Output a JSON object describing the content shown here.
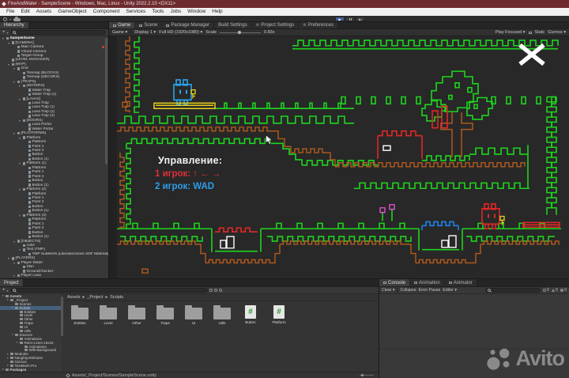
{
  "window": {
    "title": "FireAndWater - SampleScene - Windows, Mac, Linux - Unity 2022.2.10 <DX11>"
  },
  "menus": [
    "File",
    "Edit",
    "Assets",
    "GameObject",
    "Component",
    "Services",
    "Tools",
    "Jobs",
    "Window",
    "Help"
  ],
  "hierarchy": {
    "tab": "Hierarchy",
    "rows": [
      [
        0,
        "SampleScene",
        1,
        ""
      ],
      [
        1,
        "[CAMERA]",
        1,
        ""
      ],
      [
        2,
        "Main Camera",
        0,
        "red"
      ],
      [
        2,
        "Virtual Camera",
        0,
        ""
      ],
      [
        2,
        "Target Group",
        0,
        ""
      ],
      [
        1,
        "[LEVEL MANAGER]",
        0,
        ""
      ],
      [
        1,
        "[MAP]",
        1,
        ""
      ],
      [
        2,
        "Grid",
        1,
        ""
      ],
      [
        3,
        "Tilemap (BLOCKS)",
        0,
        ""
      ],
      [
        3,
        "Tilemap (DECORS)",
        0,
        ""
      ],
      [
        2,
        "[TRAPS]",
        1,
        ""
      ],
      [
        3,
        "[WATERS]",
        1,
        ""
      ],
      [
        4,
        "Water Trap",
        0,
        ""
      ],
      [
        4,
        "Water Trap (1)",
        0,
        ""
      ],
      [
        3,
        "[LAVAS]",
        1,
        ""
      ],
      [
        4,
        "Lava Trap",
        0,
        ""
      ],
      [
        4,
        "Lava Trap (1)",
        0,
        ""
      ],
      [
        4,
        "Lava Trap (2)",
        0,
        ""
      ],
      [
        4,
        "Lava Trap (3)",
        0,
        ""
      ],
      [
        3,
        "[DOORS]",
        1,
        ""
      ],
      [
        4,
        "Lava Portal",
        0,
        ""
      ],
      [
        4,
        "Water Portal",
        0,
        ""
      ],
      [
        2,
        "[PLATFORMS]",
        1,
        ""
      ],
      [
        3,
        "Platform",
        1,
        ""
      ],
      [
        4,
        "Platform",
        0,
        ""
      ],
      [
        4,
        "Point 1",
        0,
        ""
      ],
      [
        4,
        "Point 2",
        0,
        ""
      ],
      [
        4,
        "Button",
        0,
        ""
      ],
      [
        4,
        "Button (1)",
        0,
        ""
      ],
      [
        3,
        "Platform (1)",
        1,
        ""
      ],
      [
        4,
        "Platform",
        0,
        ""
      ],
      [
        4,
        "Point 1",
        0,
        ""
      ],
      [
        4,
        "Point 2",
        0,
        ""
      ],
      [
        4,
        "Button",
        0,
        ""
      ],
      [
        4,
        "Button (1)",
        0,
        ""
      ],
      [
        3,
        "Platform (2)",
        1,
        ""
      ],
      [
        4,
        "Platform",
        0,
        ""
      ],
      [
        4,
        "Point 1",
        0,
        ""
      ],
      [
        4,
        "Point 2",
        0,
        ""
      ],
      [
        4,
        "Button",
        0,
        ""
      ],
      [
        4,
        "Button (1)",
        0,
        ""
      ],
      [
        3,
        "Platform (3)",
        1,
        ""
      ],
      [
        4,
        "Platform",
        0,
        ""
      ],
      [
        4,
        "Point 1",
        0,
        ""
      ],
      [
        4,
        "Point 2",
        0,
        ""
      ],
      [
        4,
        "Button",
        0,
        ""
      ],
      [
        4,
        "Button (1)",
        0,
        ""
      ],
      [
        2,
        "[OBJECTS]",
        1,
        ""
      ],
      [
        3,
        "cube",
        0,
        ""
      ],
      [
        3,
        "Text (TMP)",
        1,
        ""
      ],
      [
        4,
        "TMP SubMesh [LiberationSans SDF Material]",
        0,
        ""
      ],
      [
        1,
        "[PLAYERS]",
        1,
        ""
      ],
      [
        2,
        "Player Water",
        1,
        ""
      ],
      [
        3,
        "Skin",
        0,
        ""
      ],
      [
        3,
        "GroundChecker",
        0,
        ""
      ],
      [
        2,
        "Player Lava",
        1,
        ""
      ]
    ]
  },
  "game": {
    "tabs": [
      {
        "label": "Game",
        "icon": "game",
        "active": true
      },
      {
        "label": "Scene",
        "icon": "scene",
        "active": false
      },
      {
        "label": "Package Manager",
        "icon": "package",
        "active": false
      },
      {
        "label": "Build Settings",
        "icon": "",
        "active": false
      },
      {
        "label": "Project Settings",
        "icon": "gear",
        "active": false
      },
      {
        "label": "Preferences",
        "icon": "gear",
        "active": false
      }
    ],
    "bar": {
      "mode": "Game",
      "display": "Display 1",
      "resolution": "Full HD (1920x1080)",
      "scale_label": "Scale",
      "scale_value": "0.83x",
      "play_focused": "Play Focused",
      "stats": "Stats",
      "gizmos": "Gizmos"
    },
    "overlay": {
      "title": "Управление:",
      "player1": "1 игрок: ↑ ← →",
      "player2": "2 игрок: WAD"
    }
  },
  "level_colors": {
    "green": "#1ed41e",
    "orange": "#b55b1c",
    "red": "#e22727",
    "blue_player": "#2aa4ee",
    "blue_water": "#1f7fe8",
    "yellow": "#e8d21f",
    "pink": "#e24fd4",
    "brown": "#a8551e",
    "white": "#ffffff",
    "bg": "#282828"
  },
  "project": {
    "tab": "Project",
    "tree": [
      [
        0,
        "Assets",
        1,
        0
      ],
      [
        1,
        "_Project",
        1,
        0
      ],
      [
        2,
        "Scenes",
        0,
        0
      ],
      [
        2,
        "Scripts",
        1,
        1
      ],
      [
        3,
        "Entities",
        0,
        0
      ],
      [
        3,
        "Level",
        0,
        0
      ],
      [
        3,
        "Other",
        0,
        0
      ],
      [
        3,
        "Traps",
        0,
        0
      ],
      [
        3,
        "UI",
        0,
        0
      ],
      [
        3,
        "Utils",
        0,
        0
      ],
      [
        2,
        "Sources",
        1,
        0
      ],
      [
        3,
        "Animations",
        0,
        0
      ],
      [
        3,
        "Retro-Lines-16x16",
        1,
        0
      ],
      [
        4,
        "Animations",
        0,
        0
      ],
      [
        4,
        "With-Background",
        0,
        0
      ],
      [
        1,
        "Modules",
        1,
        0
      ],
      [
        1,
        "NaughtyAttributes",
        1,
        0
      ],
      [
        1,
        "Gizmos",
        0,
        0
      ],
      [
        1,
        "TextMesh-Pro",
        1,
        0
      ],
      [
        0,
        "Packages",
        1,
        0
      ]
    ],
    "breadcrumb": [
      "Assets",
      "_Project",
      "Scripts"
    ],
    "items": [
      {
        "label": "Entities",
        "type": "folder"
      },
      {
        "label": "Level",
        "type": "folder"
      },
      {
        "label": "Other",
        "type": "folder"
      },
      {
        "label": "Traps",
        "type": "folder"
      },
      {
        "label": "UI",
        "type": "folder"
      },
      {
        "label": "Utils",
        "type": "folder"
      },
      {
        "label": "Button",
        "type": "script"
      },
      {
        "label": "Platform",
        "type": "script"
      }
    ],
    "footer": "Assets/_Project/Scenes/SampleScene.unity"
  },
  "console": {
    "tabs": [
      "Console",
      "Animation",
      "Animator"
    ],
    "buttons": [
      "Clear",
      "Collapse",
      "Error Pause",
      "Editor"
    ],
    "counts": [
      {
        "kind": "info",
        "value": "0"
      },
      {
        "kind": "warning",
        "value": "0"
      },
      {
        "kind": "error",
        "value": "0"
      }
    ]
  },
  "watermark": {
    "text": "Avito"
  }
}
